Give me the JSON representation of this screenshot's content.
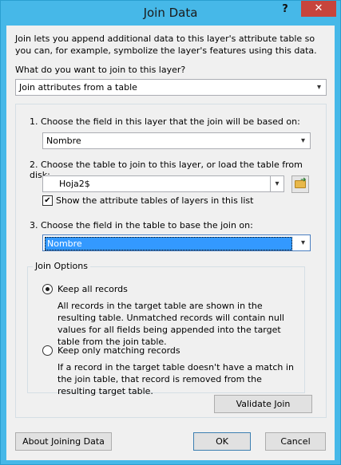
{
  "window": {
    "title": "Join Data",
    "help_glyph": "?",
    "close_glyph": "✕"
  },
  "intro": {
    "text": "Join lets you append additional data to this layer's attribute table so you can, for example, symbolize the layer's features using this data.",
    "question": "What do you want to join to this layer?",
    "join_type_value": "Join attributes from a table"
  },
  "step1": {
    "label": "1.  Choose the field in this layer that the join will be based on:",
    "value": "Nombre"
  },
  "step2": {
    "label": "2.  Choose the table to join to this layer, or load the table from disk:",
    "value": "Hoja2$",
    "show_attr_tables_label": "Show the attribute tables of layers in this list",
    "show_attr_tables_checked": "✔"
  },
  "step3": {
    "label": "3.  Choose the field in the table to base the join on:",
    "value": "Nombre"
  },
  "join_options": {
    "legend": "Join Options",
    "keep_all": {
      "label": "Keep all records",
      "desc": "All records in the target table are shown in the resulting table. Unmatched records will contain null values for all fields being appended into the target table from the join table."
    },
    "keep_matching": {
      "label": "Keep only matching records",
      "desc": "If a record in the target table doesn't have a match in the join table, that record is removed from the resulting target table."
    }
  },
  "buttons": {
    "validate": "Validate Join",
    "about": "About Joining Data",
    "ok": "OK",
    "cancel": "Cancel"
  },
  "icons": {
    "dropdown": "chevron-down-icon",
    "folder": "open-folder-icon"
  }
}
